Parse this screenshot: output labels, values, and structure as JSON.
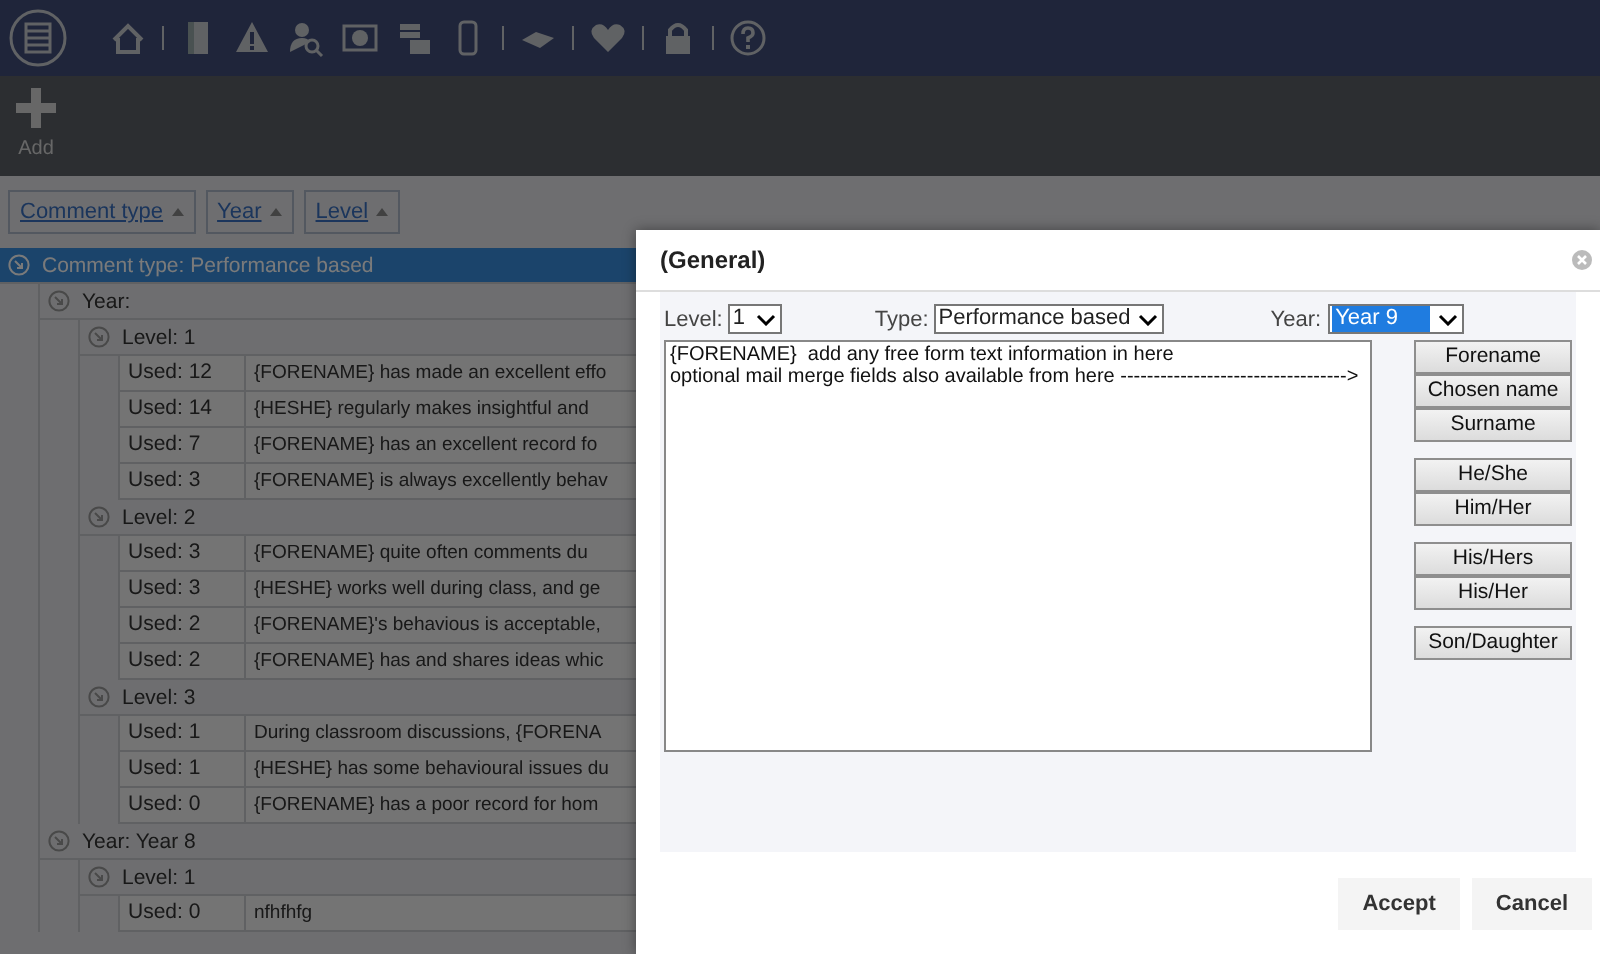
{
  "toolbar": {
    "add_label": "Add"
  },
  "group_by": [
    {
      "label": "Comment type"
    },
    {
      "label": "Year"
    },
    {
      "label": "Level"
    }
  ],
  "tree": [
    {
      "label": "Comment type: Performance based",
      "selected": true,
      "expanded": true,
      "children": [
        {
          "label": "Year:",
          "selected": false,
          "expanded": true,
          "children": [
            {
              "label": "Level: 1",
              "selected": false,
              "expanded": true,
              "rows": [
                {
                  "used": "Used: 12",
                  "text": "{FORENAME} has made an excellent effo"
                },
                {
                  "used": "Used: 14",
                  "text": "{HESHE} regularly makes insightful and"
                },
                {
                  "used": "Used: 7",
                  "text": "{FORENAME} has an excellent record fo"
                },
                {
                  "used": "Used: 3",
                  "text": "{FORENAME} is always excellently behav"
                }
              ]
            },
            {
              "label": "Level: 2",
              "selected": false,
              "expanded": true,
              "rows": [
                {
                  "used": "Used: 3",
                  "text": "{FORENAME} quite often comments du"
                },
                {
                  "used": "Used: 3",
                  "text": "{HESHE} works well during class, and ge"
                },
                {
                  "used": "Used: 2",
                  "text": "{FORENAME}'s behavious is acceptable,"
                },
                {
                  "used": "Used: 2",
                  "text": "{FORENAME} has and shares ideas whic"
                }
              ]
            },
            {
              "label": "Level: 3",
              "selected": false,
              "expanded": true,
              "rows": [
                {
                  "used": "Used: 1",
                  "text": "During classroom discussions, {FORENA"
                },
                {
                  "used": "Used: 1",
                  "text": "{HESHE} has some behavioural issues du"
                },
                {
                  "used": "Used: 0",
                  "text": "{FORENAME} has a poor record for hom"
                }
              ]
            }
          ]
        },
        {
          "label": "Year: Year 8",
          "selected": false,
          "expanded": true,
          "children": [
            {
              "label": "Level: 1",
              "selected": false,
              "expanded": true,
              "rows": [
                {
                  "used": "Used: 0",
                  "text": "nfhfhfg"
                }
              ]
            }
          ]
        }
      ]
    }
  ],
  "dialog": {
    "title": "(General)",
    "level": {
      "label": "Level:",
      "value": "1",
      "focused": false
    },
    "type": {
      "label": "Type:",
      "value": "Performance based",
      "focused": false
    },
    "year": {
      "label": "Year:",
      "value": "Year 9",
      "focused": true
    },
    "text": "{FORENAME}  add any free form text information in here\noptional mail merge fields also available from here ---------------------------------->",
    "merge_groups": [
      [
        "Forename",
        "Chosen name",
        "Surname"
      ],
      [
        "He/She",
        "Him/Her"
      ],
      [
        "His/Hers",
        "His/Her"
      ],
      [
        "Son/Daughter"
      ]
    ],
    "actions": [
      "Accept",
      "Cancel"
    ]
  }
}
